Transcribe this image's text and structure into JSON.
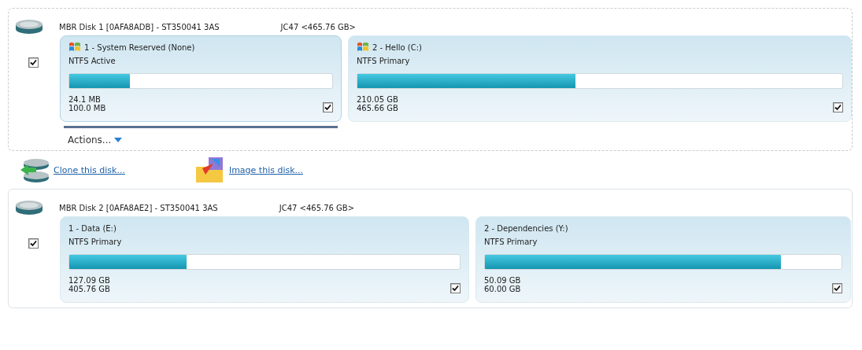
{
  "disks": [
    {
      "title": "MBR Disk 1 [0AFA8ADB] - ST350041 3AS",
      "model": "JC47  <465.76 GB>",
      "selected": true,
      "checked": true,
      "actions_label": "Actions...",
      "partitions": [
        {
          "name": "1 - System Reserved (None)",
          "type": "NTFS Active",
          "os_icon": true,
          "level": 0.23,
          "used": "24.1 MB",
          "total": "100.0 MB",
          "checked": true,
          "selected": true
        },
        {
          "name": "2 - Hello (C:)",
          "type": "NTFS Primary",
          "os_icon": true,
          "level": 0.45,
          "used": "210.05 GB",
          "total": "465.66 GB",
          "checked": true,
          "selected": false
        }
      ]
    },
    {
      "title": "MBR Disk 2 [0AFA8AE2] - ST350041 3AS",
      "model": "JC47  <465.76 GB>",
      "selected": false,
      "checked": true,
      "partitions": [
        {
          "name": "1 - Data (E:)",
          "type": "NTFS Primary",
          "os_icon": false,
          "level": 0.3,
          "used": "127.09 GB",
          "total": "405.76 GB",
          "checked": true,
          "selected": false
        },
        {
          "name": "2 - Dependencies (Y:)",
          "type": "NTFS Primary",
          "os_icon": false,
          "level": 0.83,
          "used": "50.09 GB",
          "total": "60.00 GB",
          "checked": true,
          "selected": false
        }
      ]
    }
  ],
  "links": [
    {
      "kind": "clone",
      "label": "Clone this disk..."
    },
    {
      "kind": "image",
      "label": "Image this disk..."
    }
  ]
}
